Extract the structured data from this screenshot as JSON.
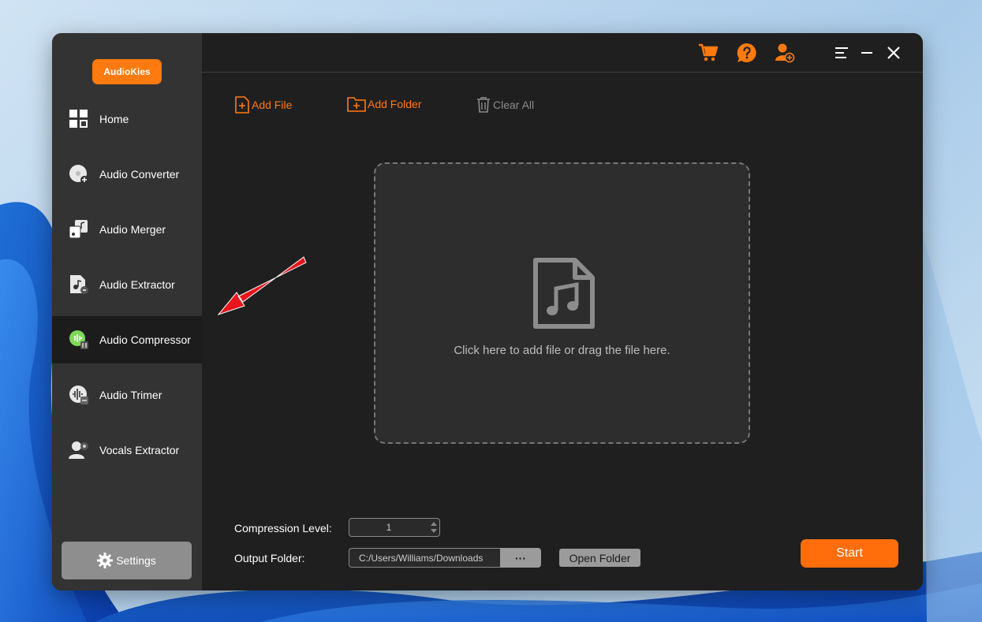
{
  "app": {
    "brand": "AudioKies",
    "accent_color": "#ff7a0f"
  },
  "sidebar": {
    "items": [
      {
        "label": "Home",
        "icon": "home-grid-icon",
        "active": false
      },
      {
        "label": "Audio Converter",
        "icon": "audio-converter-icon",
        "active": false
      },
      {
        "label": "Audio Merger",
        "icon": "audio-merger-icon",
        "active": false
      },
      {
        "label": "Audio Extractor",
        "icon": "audio-extractor-icon",
        "active": false
      },
      {
        "label": "Audio Compressor",
        "icon": "audio-compressor-icon",
        "active": true
      },
      {
        "label": "Audio Trimer",
        "icon": "audio-trimmer-icon",
        "active": false
      },
      {
        "label": "Vocals Extractor",
        "icon": "vocals-extractor-icon",
        "active": false
      }
    ],
    "settings_label": "Settings"
  },
  "topbar": {
    "icons": [
      "cart-icon",
      "help-icon",
      "account-icon",
      "menu-icon",
      "minimize-icon",
      "close-icon"
    ]
  },
  "toolbar": {
    "add_file": "Add File",
    "add_folder": "Add Folder",
    "clear_all": "Clear All"
  },
  "dropzone": {
    "text": "Click here to add file or drag the file here.",
    "icon": "music-file-icon"
  },
  "settings_panel": {
    "compression_label": "Compression Level:",
    "compression_value": "1",
    "output_label": "Output Folder:",
    "output_path": "C:/Users/Williams/Downloads",
    "browse_label": "···",
    "open_folder_label": "Open Folder"
  },
  "start_label": "Start",
  "annotation": {
    "arrow_color": "#e8141c",
    "points_to": "Audio Compressor"
  }
}
